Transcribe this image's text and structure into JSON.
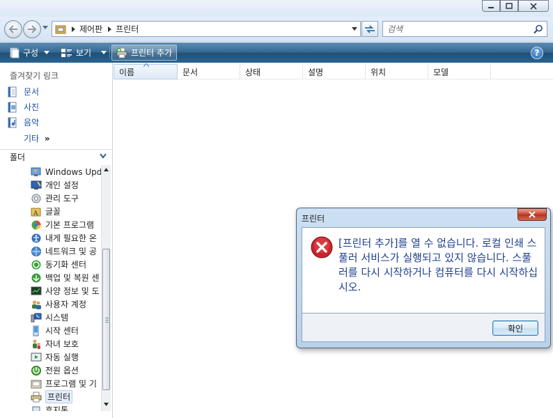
{
  "window": {
    "caption_buttons": [
      "minimize-icon",
      "maximize-icon",
      "close-icon"
    ]
  },
  "address_bar": {
    "breadcrumb": [
      "제어판",
      "프린터"
    ],
    "search_placeholder": "검색"
  },
  "command_bar": {
    "organize_label": "구성",
    "views_label": "보기",
    "add_printer_label": "프린터 추가",
    "help_label": "?"
  },
  "navigation": {
    "favorites_header": "즐겨찾기 링크",
    "favorites": [
      {
        "label": "문서",
        "icon": "documents-icon"
      },
      {
        "label": "사진",
        "icon": "pictures-icon"
      },
      {
        "label": "음악",
        "icon": "music-icon"
      }
    ],
    "more_label": "기타",
    "more_glyph": "»",
    "folders_header": "폴더",
    "tree": [
      {
        "label": "Windows Upd...",
        "icon": "windows-update-icon"
      },
      {
        "label": "개인 설정",
        "icon": "personalization-icon"
      },
      {
        "label": "관리 도구",
        "icon": "admin-tools-icon"
      },
      {
        "label": "글꼴",
        "icon": "fonts-icon"
      },
      {
        "label": "기본 프로그램",
        "icon": "default-programs-icon"
      },
      {
        "label": "내게 필요한 온",
        "icon": "ease-of-access-icon"
      },
      {
        "label": "네트워크 및 공",
        "icon": "network-icon"
      },
      {
        "label": "동기화 센터",
        "icon": "sync-center-icon"
      },
      {
        "label": "백업 및 복원 센",
        "icon": "backup-icon"
      },
      {
        "label": "사양 정보 및 도",
        "icon": "performance-icon"
      },
      {
        "label": "사용자 계정",
        "icon": "user-accounts-icon"
      },
      {
        "label": "시스템",
        "icon": "system-icon"
      },
      {
        "label": "시작 센터",
        "icon": "welcome-center-icon"
      },
      {
        "label": "자녀 보호",
        "icon": "parental-controls-icon"
      },
      {
        "label": "자동 실행",
        "icon": "autoplay-icon"
      },
      {
        "label": "전원 옵션",
        "icon": "power-options-icon"
      },
      {
        "label": "프로그램 및 기",
        "icon": "programs-features-icon"
      },
      {
        "label": "프린터",
        "icon": "printer-icon",
        "selected": true
      },
      {
        "label": "휴지통",
        "icon": "recycle-bin-icon"
      }
    ]
  },
  "file_list": {
    "columns": [
      "이름",
      "문서",
      "상태",
      "설명",
      "위치",
      "모델"
    ],
    "sorted_column": "이름"
  },
  "dialog": {
    "title": "프린터",
    "message": "[프린터 추가]를 열 수 없습니다. 로컬 인쇄 스풀러 서비스가 실행되고 있지 않습니다. 스풀러를 다시 시작하거나 컴퓨터를 다시 시작하십시오.",
    "ok_label": "확인",
    "icon": "error-icon"
  },
  "colors": {
    "command_bar": "#2a6390",
    "link_text": "#1a4f9c",
    "dialog_message": "#1f3f8f",
    "error_red": "#c8262c"
  }
}
